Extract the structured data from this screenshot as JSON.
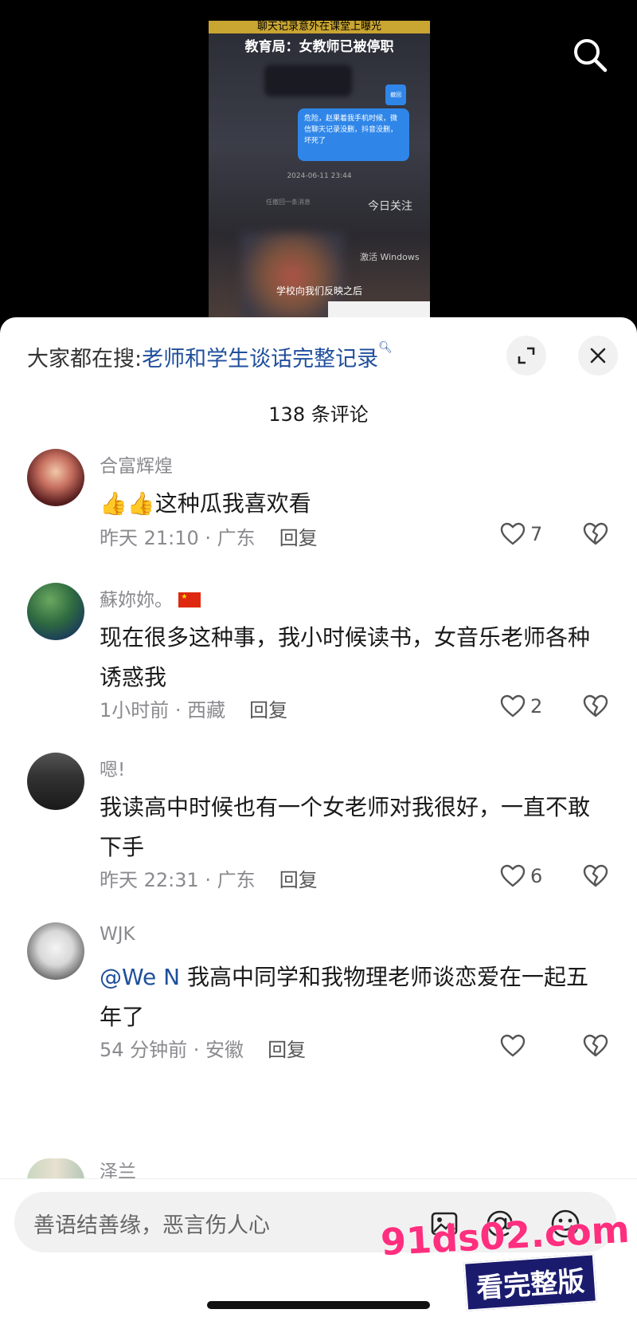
{
  "video": {
    "top_text": "聊天记录意外在课堂上曝光",
    "caption": "教育局：女教师已被停职",
    "bubble_text": "危险，赵果着我手机时候，微信聊天记录没删，抖音没删，坏死了",
    "small_bubble": "撤回",
    "date": "2024-06-11 23:44",
    "sub1": "任撤回一条消息",
    "watermark": "今日关注",
    "windows_text": "激活 Windows",
    "subtitle": "学校向我们反映之后"
  },
  "header": {
    "hot_prefix": "大家都在搜:",
    "hot_query": "老师和学生谈话完整记录",
    "comment_count": "138 条评论"
  },
  "comments": [
    {
      "name": "合富辉煌",
      "text": "这种瓜我喜欢看",
      "time": "昨天 21:10 · 广东",
      "reply": "回复",
      "likes": "7"
    },
    {
      "name": "蘇妳妳。",
      "text": "现在很多这种事，我小时候读书，女音乐老师各种诱惑我",
      "time": "1小时前 · 西藏",
      "reply": "回复",
      "likes": "2"
    },
    {
      "name": "嗯!",
      "text": "我读高中时候也有一个女老师对我很好，一直不敢下手",
      "time": "昨天 22:31 · 广东",
      "reply": "回复",
      "likes": "6"
    },
    {
      "name": "WJK",
      "mention": "@We N",
      "text": " 我高中同学和我物理老师谈恋爱在一起五年了",
      "time": "54 分钟前 · 安徽",
      "reply": "回复",
      "likes": ""
    },
    {
      "name": "泽兰"
    }
  ],
  "input": {
    "placeholder": "善语结善缘，恶言伤人心"
  },
  "watermark": {
    "site": "91ds02.com",
    "tag": "看完整版"
  },
  "colors": {
    "link": "#1f4f9c",
    "watermark_pink": "#ff2e7e",
    "watermark_navy": "#1b1b6e"
  }
}
